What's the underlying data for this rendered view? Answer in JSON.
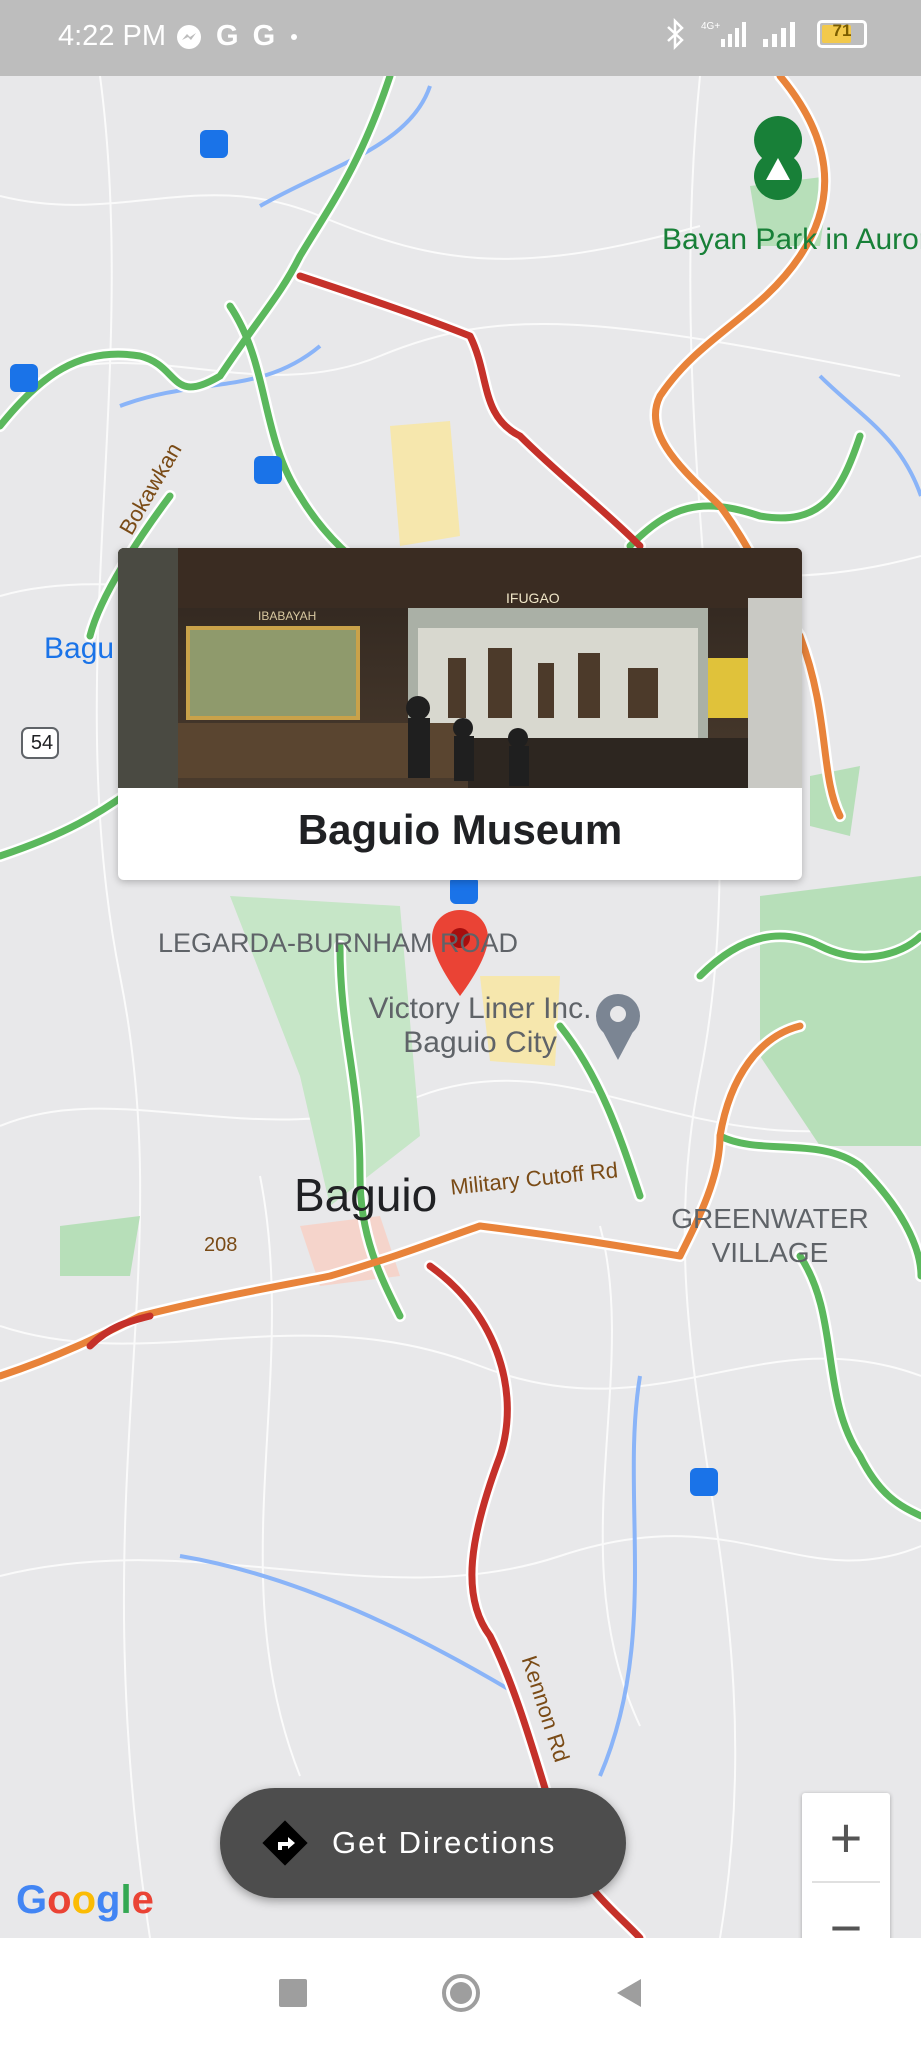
{
  "status_bar": {
    "time": "4:22 PM",
    "left_icons": [
      "messenger-icon",
      "google-icon",
      "google-icon",
      "dot"
    ],
    "right_icons": [
      "bluetooth-icon",
      "4g-signal-icon",
      "signal-icon"
    ],
    "battery_level": "71"
  },
  "map": {
    "labels": {
      "park": "Bayan Park in Aurora Hill",
      "bokawkan": "Bokawkan",
      "baguio_side": "Bagu",
      "route_54": "54",
      "legarda": "LEGARDA-BURNHAM ROAD",
      "victory": "Victory Liner Inc. Baguio City",
      "city": "Baguio",
      "military": "Military Cutoff Rd",
      "greenwater": "GREENWATER VILLAGE",
      "route_208": "208",
      "kennon": "Kennon Rd"
    },
    "colors": {
      "traffic_green": "#5bb85d",
      "traffic_orange": "#e8833a",
      "traffic_red": "#c5312a",
      "park_green": "#b7dfb9",
      "water_blue": "#8ab4f8",
      "pin_red": "#ea4335",
      "transit_blue": "#1a73e8"
    }
  },
  "info_card": {
    "title": "Baguio Museum",
    "photo_labels": [
      "IBABAYAH",
      "IFUGAO"
    ]
  },
  "zoom": {
    "in_label": "+",
    "out_label": "−"
  },
  "directions_button": {
    "label": "Get Directions"
  },
  "google_logo": {
    "letters": [
      "G",
      "o",
      "o",
      "g",
      "l",
      "e"
    ],
    "colors": [
      "#4285f4",
      "#ea4335",
      "#fbbc05",
      "#4285f4",
      "#34a853",
      "#ea4335"
    ]
  }
}
